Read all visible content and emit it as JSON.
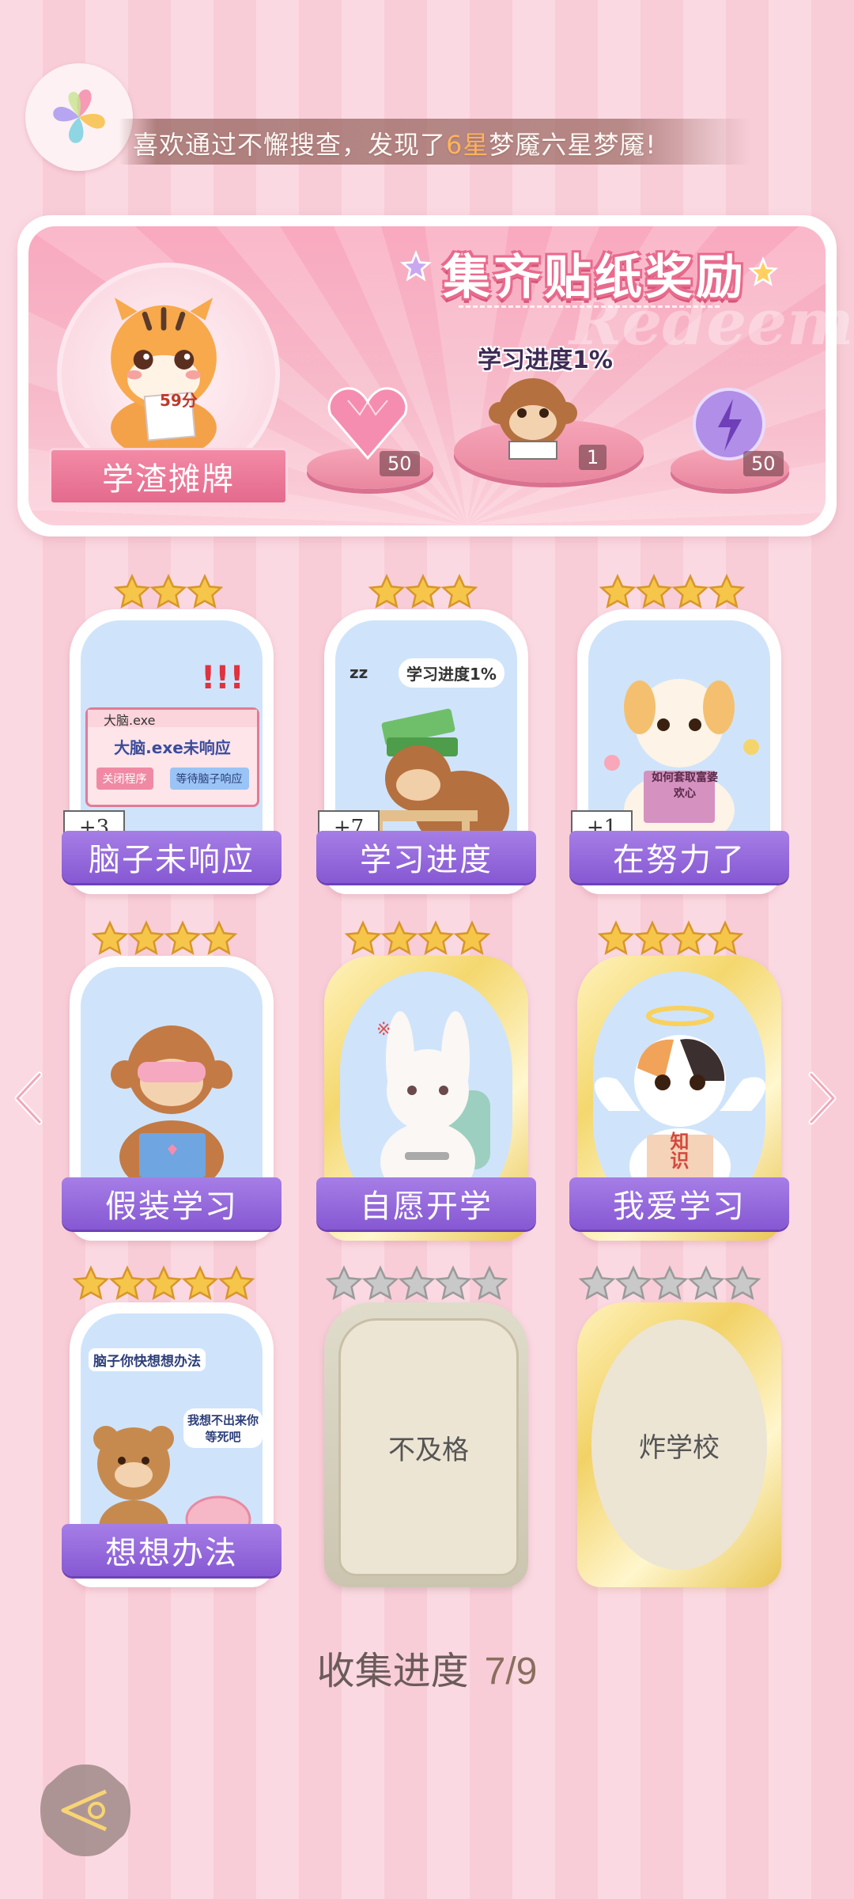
{
  "ticker": {
    "prefix": "喜欢通过不懈搜查，发现了",
    "highlight": "6星",
    "suffix": "梦魇六星梦魇!"
  },
  "banner": {
    "title": "集齐贴纸奖励",
    "watermark": "Redeem",
    "main_reward_label": "学渣摊牌",
    "tiger_note": "59分",
    "center_caption": "学习进度1%",
    "rewards": [
      {
        "icon": "pink-heart-gem-icon",
        "qty": "50"
      },
      {
        "icon": "monkey-reading-icon",
        "qty": "1"
      },
      {
        "icon": "purple-energy-orb-icon",
        "qty": "50"
      }
    ]
  },
  "cards": [
    {
      "label": "脑子未响应",
      "stars": 3,
      "badge": "+3",
      "art_text_1": "大脑.exe",
      "art_text_2": "大脑.exe未响应",
      "btn1": "关闭程序",
      "btn2": "等待脑子响应",
      "frame": "normal"
    },
    {
      "label": "学习进度",
      "stars": 3,
      "badge": "+7",
      "art_text_1": "学习进度1%",
      "frame": "normal"
    },
    {
      "label": "在努力了",
      "stars": 4,
      "badge": "+1",
      "art_text_1": "如何套取富婆欢心",
      "frame": "normal"
    },
    {
      "label": "假装学习",
      "stars": 4,
      "frame": "normal"
    },
    {
      "label": "自愿开学",
      "stars": 4,
      "frame": "gold"
    },
    {
      "label": "我爱学习",
      "stars": 4,
      "art_text_1": "知识",
      "frame": "gold"
    },
    {
      "label": "想想办法",
      "stars": 5,
      "art_text_1": "脑子你快想想办法",
      "art_text_2": "我想不出来你等死吧",
      "frame": "normal"
    },
    {
      "label": "不及格",
      "stars": 5,
      "locked": true,
      "frame": "silver"
    },
    {
      "label": "炸学校",
      "stars": 5,
      "locked": true,
      "frame": "gold"
    }
  ],
  "progress": {
    "label": "收集进度",
    "value": "7/9"
  },
  "colors": {
    "accent_purple": "#8658d3",
    "ticker_highlight": "#ffb35a",
    "star_gold": "#f5c64a",
    "star_silver": "#c9c9c9"
  }
}
